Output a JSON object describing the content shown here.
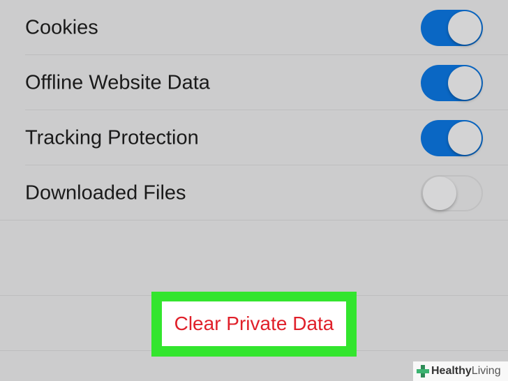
{
  "settings": {
    "items": [
      {
        "label": "Cookies",
        "enabled": true
      },
      {
        "label": "Offline Website Data",
        "enabled": true
      },
      {
        "label": "Tracking Protection",
        "enabled": true
      },
      {
        "label": "Downloaded Files",
        "enabled": false
      }
    ]
  },
  "actions": {
    "clear_label": "Clear Private Data"
  },
  "watermark": {
    "brand_bold": "Healthy",
    "brand_light": "Living"
  },
  "colors": {
    "background": "#cccccd",
    "toggle_on": "#0a67c4",
    "destructive_text": "#e0202a",
    "highlight": "#33e52e"
  }
}
